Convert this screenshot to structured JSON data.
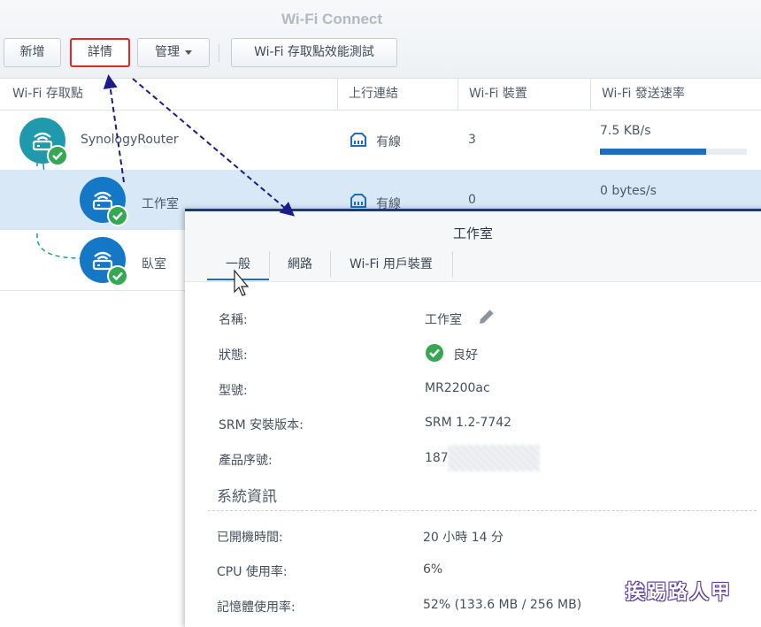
{
  "app": {
    "title": "Wi-Fi Connect"
  },
  "toolbar": {
    "create": "新增",
    "details": "詳情",
    "manage": "管理",
    "perf_test": "Wi-Fi 存取點效能測試"
  },
  "table": {
    "columns": [
      "Wi-Fi 存取點",
      "上行連結",
      "Wi-Fi 裝置",
      "Wi-Fi 發送速率"
    ],
    "rows": [
      {
        "name": "SynologyRouter",
        "uplink": "有線",
        "devices": "3",
        "rate": "7.5 KB/s",
        "rate_bar_fraction": 0.72
      },
      {
        "name": "工作室",
        "uplink": "有線",
        "devices": "0",
        "rate": "0 bytes/s"
      },
      {
        "name": "臥室"
      }
    ]
  },
  "dialog": {
    "title": "工作室",
    "tabs": [
      "一般",
      "網路",
      "Wi-Fi 用戶裝置"
    ],
    "fields": {
      "name_label": "名稱:",
      "name_value": "工作室",
      "status_label": "狀態:",
      "status_value": "良好",
      "model_label": "型號:",
      "model_value": "MR2200ac",
      "srm_label": "SRM 安裝版本:",
      "srm_value": "SRM 1.2-7742",
      "serial_label": "產品序號:",
      "serial_value": "187"
    },
    "section_title": "系統資訊",
    "system": {
      "uptime_label": "已開機時間:",
      "uptime_value": "20 小時 14 分",
      "cpu_label": "CPU 使用率:",
      "cpu_value": "6%",
      "mem_label": "記憶體使用率:",
      "mem_value": "52% (133.6 MB / 256 MB)"
    }
  },
  "watermark": "挨踢路人甲",
  "colors": {
    "accent": "#1c6fc0",
    "router_icon": "#1e9aac",
    "point_icon": "#1478c6",
    "ok": "#34a853",
    "highlight_border": "#e02a2a"
  }
}
